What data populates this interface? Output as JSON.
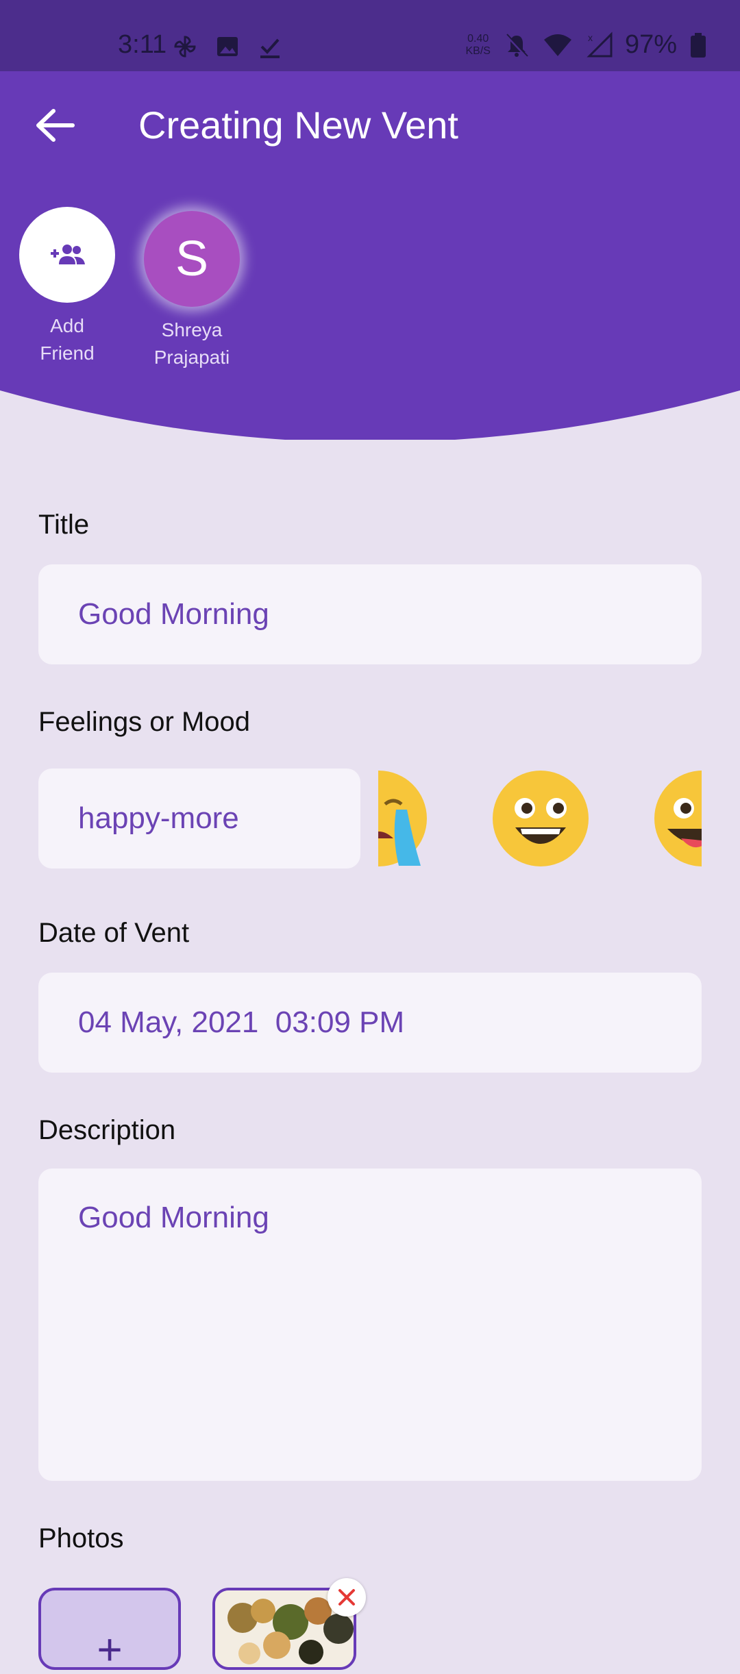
{
  "status_bar": {
    "time": "3:11",
    "net_speed_value": "0.40",
    "net_speed_unit": "KB/S",
    "battery": "97%"
  },
  "app_bar": {
    "title": "Creating New Vent"
  },
  "friends": [
    {
      "label_line1": "Add",
      "label_line2": "Friend",
      "icon": "add-people-icon"
    },
    {
      "initial": "S",
      "label_line1": "Shreya",
      "label_line2": "Prajapati"
    }
  ],
  "form": {
    "title_label": "Title",
    "title_value": "Good Morning",
    "mood_label": "Feelings or Mood",
    "mood_value": "happy-more",
    "date_label": "Date of Vent",
    "date_value": "04 May, 2021  03:09 PM",
    "description_label": "Description",
    "description_value": "Good Morning",
    "photos_label": "Photos",
    "add_photo_symbol": "+"
  },
  "colors": {
    "primary": "#673ab7",
    "status_bar": "#4c2d8c",
    "background": "#e8e1f0",
    "field": "#f6f3fa",
    "field_text": "#6b43b4",
    "avatar": "#a84ec0"
  }
}
